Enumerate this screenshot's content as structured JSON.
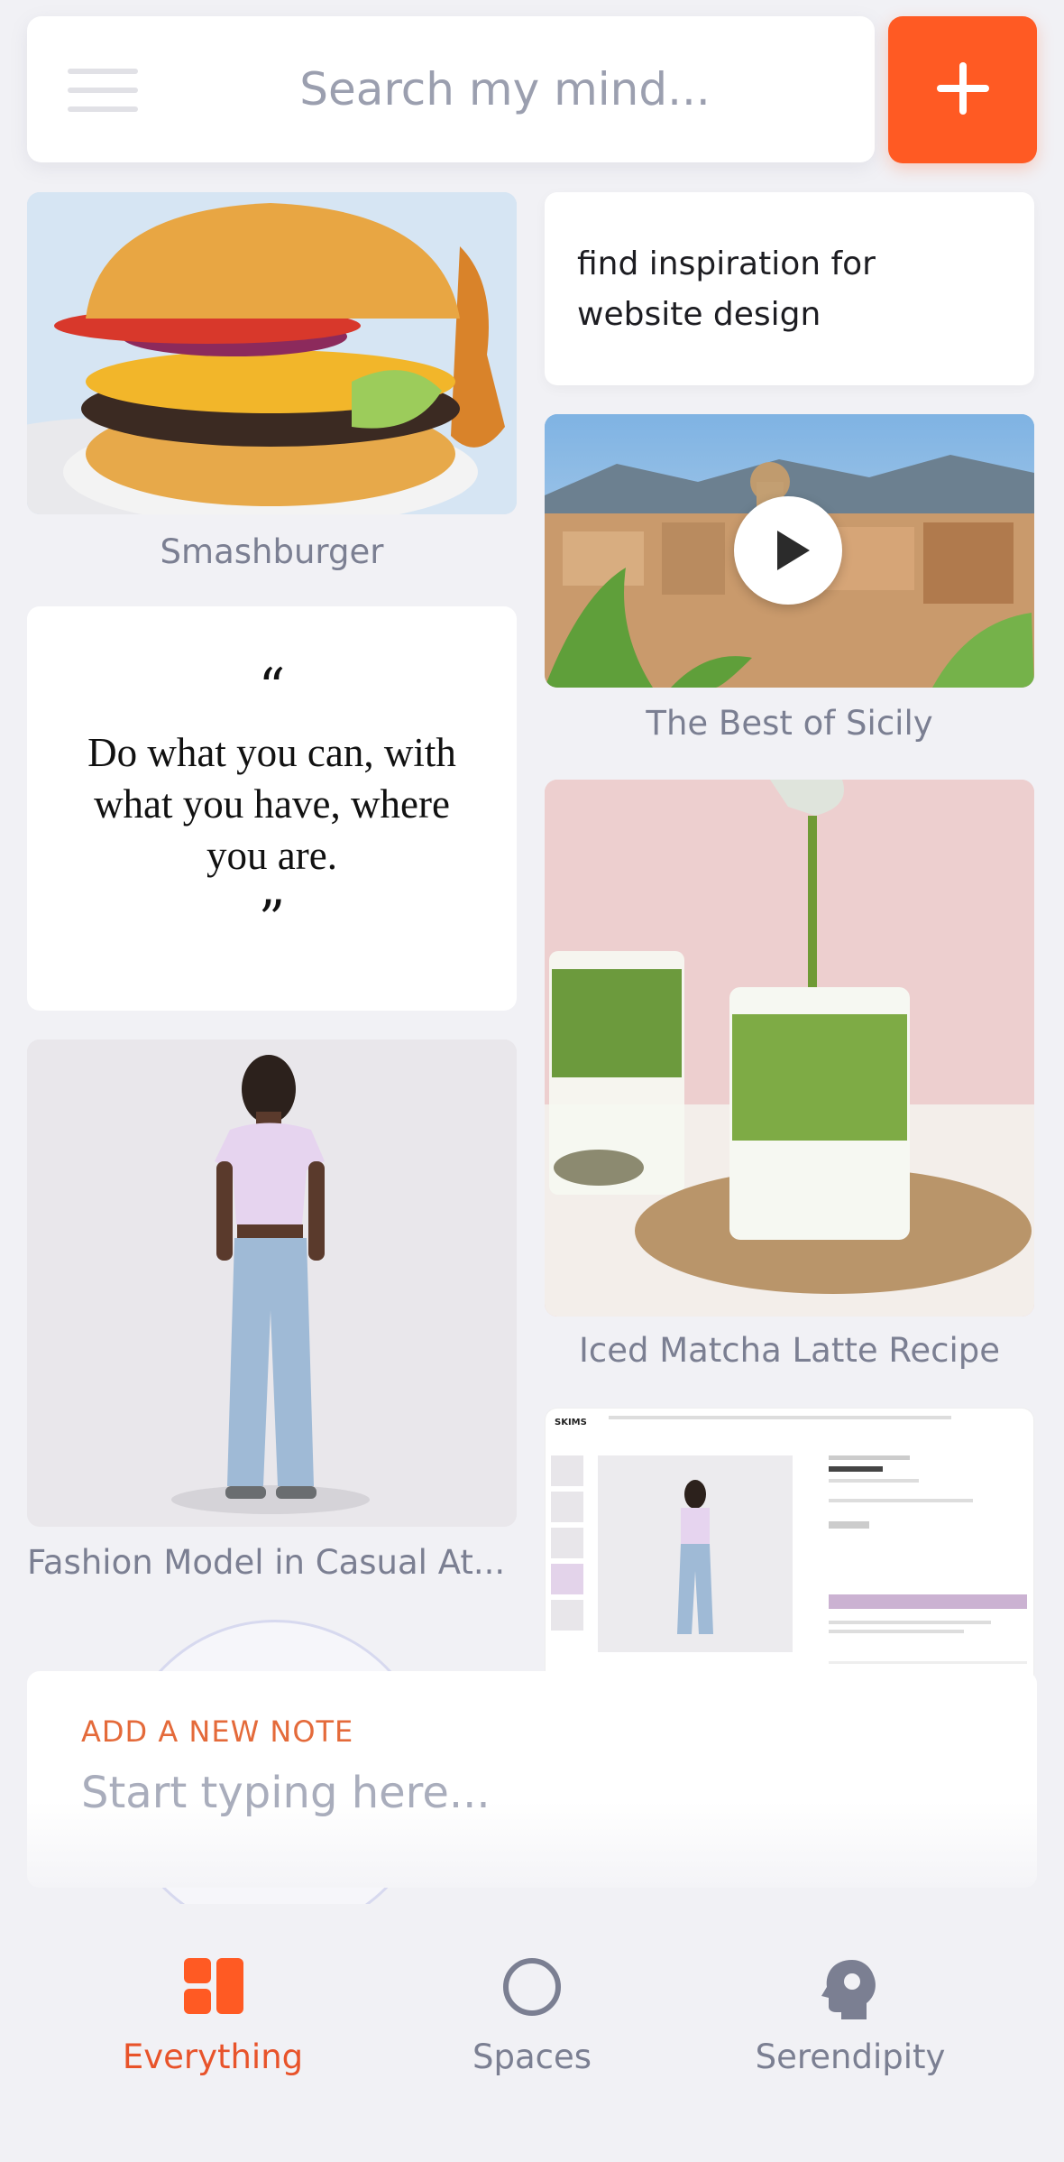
{
  "search": {
    "placeholder": "Search my mind..."
  },
  "cards": {
    "burger_caption": "Smashburger",
    "inspiration_text": "find inspiration for website design",
    "sicily_caption": "The Best of Sicily",
    "quote": {
      "open_mark": "“",
      "text": "Do what you can, with what you have, where you are.",
      "close_mark": "”"
    },
    "matcha_caption": "Iced Matcha Latte Recipe",
    "fashion_caption": "Fashion Model in Casual At...",
    "webpage_brand": "SKIMS"
  },
  "note": {
    "label": "ADD A NEW NOTE",
    "placeholder": "Start typing here..."
  },
  "nav": {
    "everything": "Everything",
    "spaces": "Spaces",
    "serendipity": "Serendipity"
  },
  "colors": {
    "accent": "#ff5a23",
    "nav_active": "#e8532a",
    "nav_inactive": "#7b7f92"
  },
  "icons": {
    "menu": "hamburger-icon",
    "add": "plus-icon",
    "play": "play-icon",
    "everything": "grid-icon",
    "spaces": "circle-icon",
    "serendipity": "head-icon"
  }
}
